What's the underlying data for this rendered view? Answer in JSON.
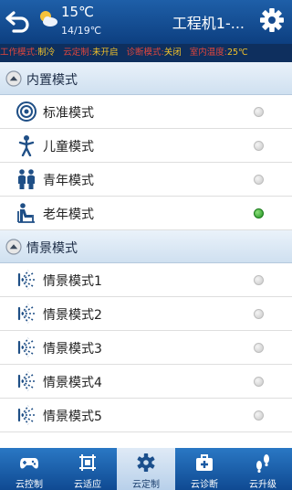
{
  "header": {
    "temp_now": "15℃",
    "temp_range": "14/19℃",
    "title": "工程机1-..."
  },
  "status": {
    "mode_label": "工作模式:",
    "mode_value": "制冷",
    "cloud_label": "云定制:",
    "cloud_value": "未开启",
    "diag_label": "诊断模式:",
    "diag_value": "关闭",
    "indoor_label": "室内温度:",
    "indoor_value": "25℃"
  },
  "sections": [
    {
      "label": "内置模式",
      "items": [
        {
          "label": "标准模式",
          "icon": "target-icon",
          "selected": false
        },
        {
          "label": "儿童模式",
          "icon": "child-icon",
          "selected": false
        },
        {
          "label": "青年模式",
          "icon": "couple-icon",
          "selected": false
        },
        {
          "label": "老年模式",
          "icon": "elder-icon",
          "selected": true
        }
      ]
    },
    {
      "label": "情景模式",
      "items": [
        {
          "label": "情景模式1",
          "icon": "airflow-icon",
          "selected": false
        },
        {
          "label": "情景模式2",
          "icon": "airflow-icon",
          "selected": false
        },
        {
          "label": "情景模式3",
          "icon": "airflow-icon",
          "selected": false
        },
        {
          "label": "情景模式4",
          "icon": "airflow-icon",
          "selected": false
        },
        {
          "label": "情景模式5",
          "icon": "airflow-icon",
          "selected": false
        }
      ]
    }
  ],
  "nav": [
    {
      "label": "云控制",
      "icon": "gamepad-icon",
      "active": false
    },
    {
      "label": "云适应",
      "icon": "frame-icon",
      "active": false
    },
    {
      "label": "云定制",
      "icon": "gear-icon",
      "active": true
    },
    {
      "label": "云诊断",
      "icon": "medkit-icon",
      "active": false
    },
    {
      "label": "云升级",
      "icon": "footprint-icon",
      "active": false
    }
  ],
  "colors": {
    "header": "#1e5fa8",
    "status_bar": "#0e2f5e",
    "status_label": "#e0463c",
    "status_value": "#f2c029",
    "selected_radio": "#1f8f1f"
  }
}
